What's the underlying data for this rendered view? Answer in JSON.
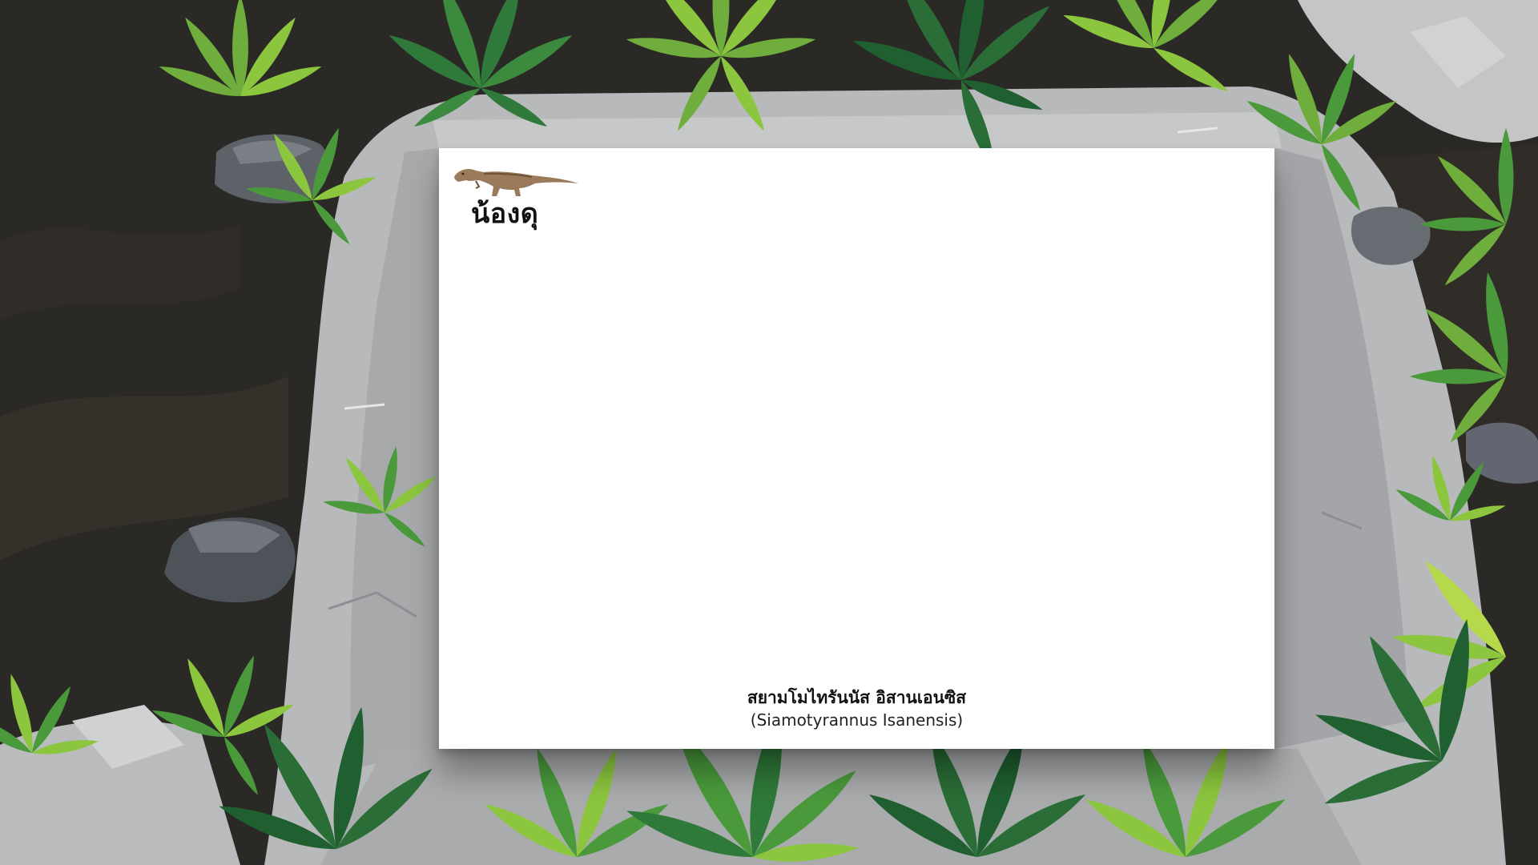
{
  "board": {
    "logo_text": "น้องดุ",
    "caption_thai": "สยามโมไทรันนัส อิสานเอนซิส",
    "caption_latin": "(Siamotyrannus Isanensis)"
  },
  "decor": {
    "icons": [
      "dinosaur-icon",
      "leaf-icon",
      "rock-icon"
    ]
  },
  "colors": {
    "cave_dark": "#2a2824",
    "rock_light": "#b9bbbd",
    "rock_mid": "#9a9c9f",
    "leaf_dark": "#2f7a3a",
    "leaf_mid": "#4a9a3c",
    "leaf_light": "#8cc63f",
    "board": "#ffffff"
  }
}
